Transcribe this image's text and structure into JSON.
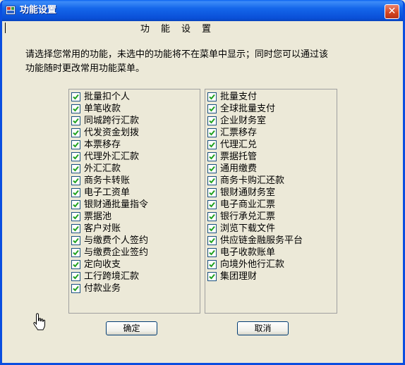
{
  "window": {
    "title": "功能设置",
    "close_label": "✕"
  },
  "heading": [
    "功",
    "能",
    "设",
    "置"
  ],
  "description": [
    "请选择您常用的功能，未选中的功能将不在菜单中显示；同时您可以通过该",
    "功能随时更改常用功能菜单。"
  ],
  "left_list": [
    {
      "label": "批量扣个人",
      "checked": true
    },
    {
      "label": "单笔收款",
      "checked": true
    },
    {
      "label": "同城跨行汇款",
      "checked": true
    },
    {
      "label": "代发资金划拨",
      "checked": true
    },
    {
      "label": "本票移存",
      "checked": true
    },
    {
      "label": "代理外汇汇款",
      "checked": true
    },
    {
      "label": "外汇汇款",
      "checked": true
    },
    {
      "label": "商务卡转账",
      "checked": true
    },
    {
      "label": "电子工资单",
      "checked": true
    },
    {
      "label": "银财通批量指令",
      "checked": true
    },
    {
      "label": "票据池",
      "checked": true
    },
    {
      "label": "客户对账",
      "checked": true
    },
    {
      "label": "与缴费个人签约",
      "checked": true
    },
    {
      "label": "与缴费企业签约",
      "checked": true
    },
    {
      "label": "定向收支",
      "checked": true
    },
    {
      "label": "工行跨境汇款",
      "checked": true
    },
    {
      "label": "付款业务",
      "checked": true
    }
  ],
  "right_list": [
    {
      "label": "批量支付",
      "checked": true
    },
    {
      "label": "全球批量支付",
      "checked": true
    },
    {
      "label": "企业财务室",
      "checked": true
    },
    {
      "label": "汇票移存",
      "checked": true
    },
    {
      "label": "代理汇兑",
      "checked": true
    },
    {
      "label": "票据托管",
      "checked": true
    },
    {
      "label": "通用缴费",
      "checked": true
    },
    {
      "label": "商务卡购汇还款",
      "checked": true
    },
    {
      "label": "银财通财务室",
      "checked": true
    },
    {
      "label": "电子商业汇票",
      "checked": true
    },
    {
      "label": "银行承兑汇票",
      "checked": true
    },
    {
      "label": "浏览下载文件",
      "checked": true
    },
    {
      "label": "供应链金融服务平台",
      "checked": true
    },
    {
      "label": "电子收款账单",
      "checked": true
    },
    {
      "label": "向境外他行汇款",
      "checked": true
    },
    {
      "label": "集团理财",
      "checked": true
    }
  ],
  "buttons": {
    "ok": "确定",
    "cancel": "取消"
  },
  "colors": {
    "titlebar": "#0a50d8",
    "window_bg": "#ece9d8",
    "check": "#21a121",
    "close_button": "#d2441f"
  }
}
